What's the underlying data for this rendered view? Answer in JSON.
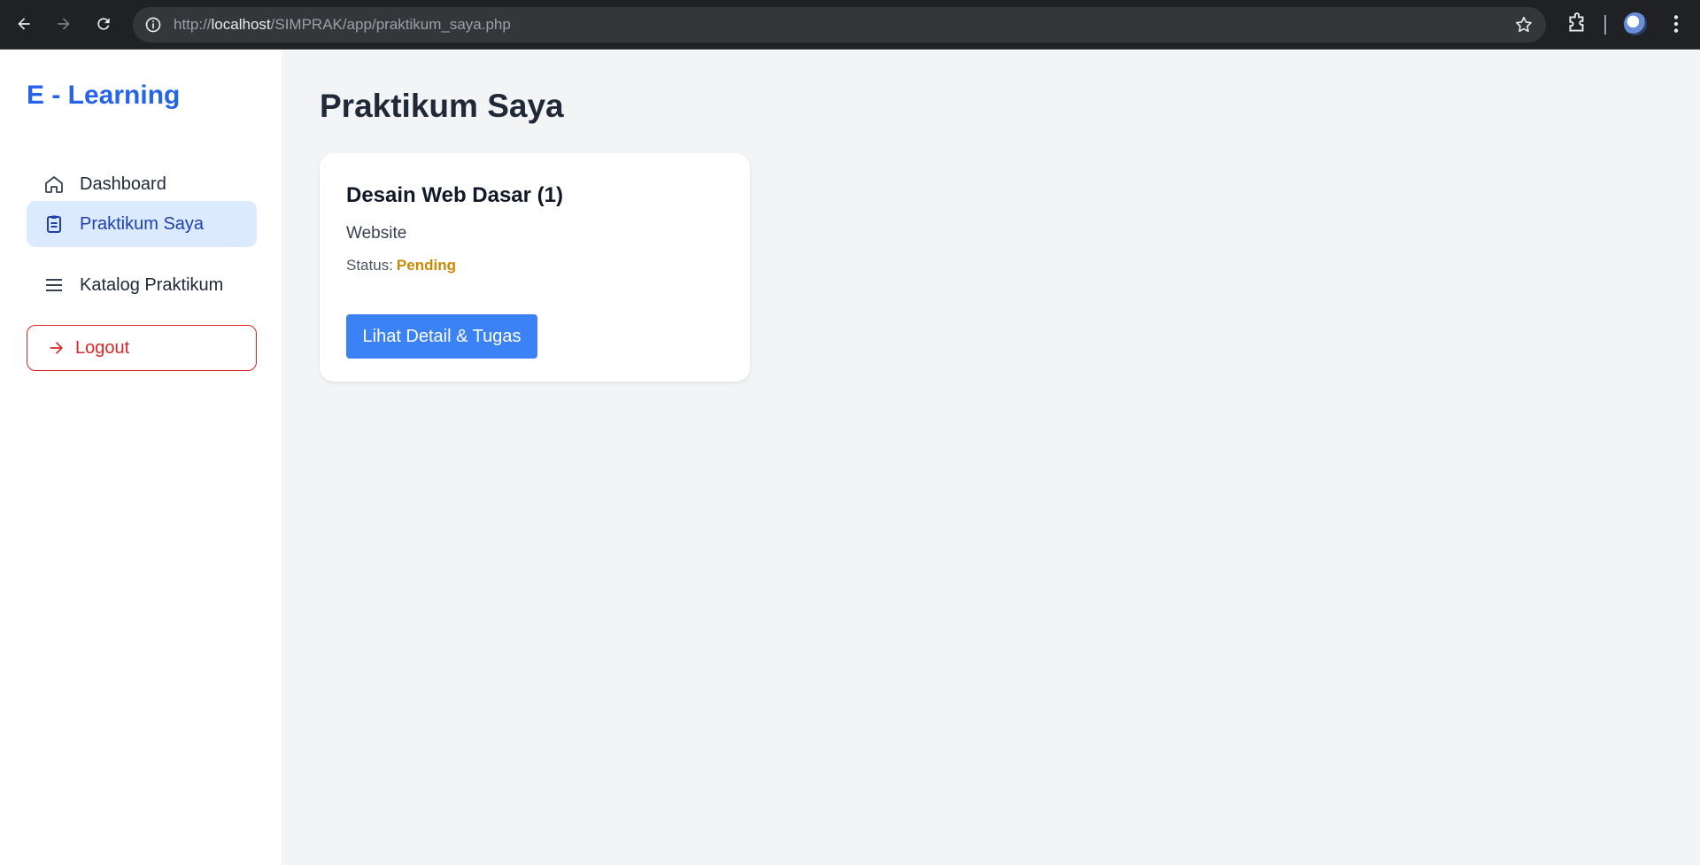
{
  "browser": {
    "url_scheme": "http://",
    "url_host": "localhost",
    "url_path": "/SIMPRAK/app/praktikum_saya.php",
    "icons": [
      "back-icon",
      "forward-icon",
      "reload-icon",
      "info-icon",
      "star-icon",
      "extensions-icon",
      "avatar",
      "menu-icon"
    ]
  },
  "sidebar": {
    "brand": "E - Learning",
    "items": [
      {
        "label": "Dashboard",
        "icon": "home-icon",
        "active": false
      },
      {
        "label": "Praktikum Saya",
        "icon": "clipboard-icon",
        "active": true
      },
      {
        "label": "Katalog Praktikum",
        "icon": "list-icon",
        "active": false
      }
    ],
    "logout_label": "Logout",
    "logout_icon": "arrow-right-icon"
  },
  "main": {
    "title": "Praktikum Saya",
    "cards": [
      {
        "title": "Desain Web Dasar (1)",
        "subtitle": "Website",
        "status_label": "Status:",
        "status_value": "Pending",
        "button_label": "Lihat Detail & Tugas"
      }
    ]
  },
  "colors": {
    "brand": "#2563eb",
    "active_bg": "#dbeafe",
    "logout": "#dc2626",
    "pending": "#ca8a04",
    "primary_button": "#3b82f6",
    "main_bg": "#f3f4f6"
  }
}
